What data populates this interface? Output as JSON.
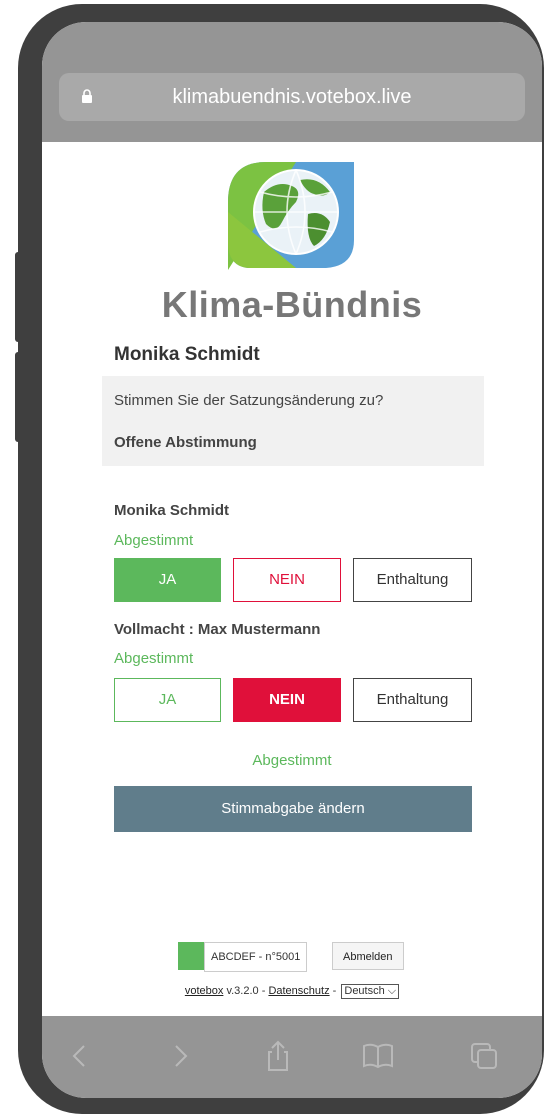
{
  "browser": {
    "url": "klimabuendnis.votebox.live"
  },
  "brand": {
    "name": "Klima-Bündnis"
  },
  "user": {
    "name": "Monika Schmidt"
  },
  "question": {
    "text": "Stimmen Sie der Satzungsänderung zu?",
    "status": "Offene Abstimmung"
  },
  "votes": [
    {
      "voter": "Monika Schmidt",
      "status": "Abgestimmt",
      "ja": "JA",
      "nein": "NEIN",
      "enthaltung": "Enthaltung",
      "selected": "JA"
    },
    {
      "voter": "Vollmacht : Max Mustermann",
      "status": "Abgestimmt",
      "ja": "JA",
      "nein": "NEIN",
      "enthaltung": "Enthaltung",
      "selected": "NEIN"
    }
  ],
  "overall_status": "Abgestimmt",
  "change_button": "Stimmabgabe ändern",
  "footer": {
    "session_code": "ABCDEF - n°5001",
    "logout": "Abmelden",
    "app_name": "votebox",
    "version": " v.3.2.0 - ",
    "privacy": "Datenschutz",
    "separator": " - ",
    "language": "Deutsch"
  },
  "colors": {
    "accent_green": "#5cb85c",
    "accent_red": "#e0103a",
    "button_gray": "#607d8b"
  }
}
